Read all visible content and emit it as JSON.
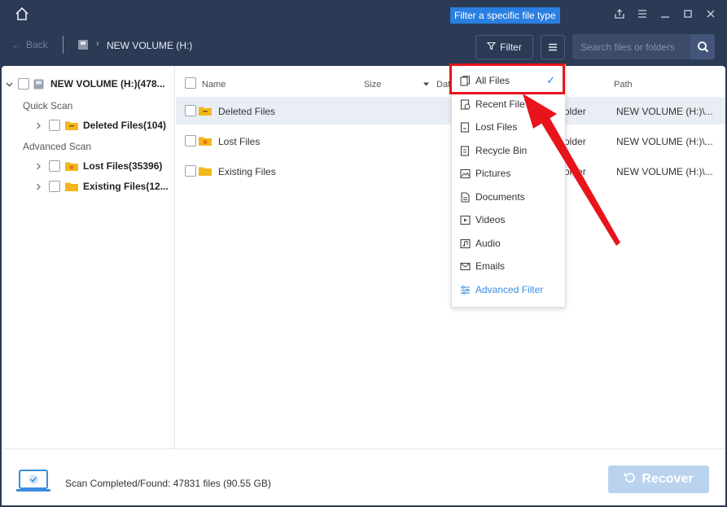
{
  "tooltip": "Filter a specific file type",
  "nav": {
    "back_label": "Back",
    "breadcrumb": "NEW VOLUME (H:)",
    "filter_label": "Filter",
    "search_placeholder": "Search files or folders"
  },
  "sidebar": {
    "root_label": "NEW VOLUME (H:)(478...",
    "quick_scan_label": "Quick Scan",
    "advanced_scan_label": "Advanced Scan",
    "items": [
      {
        "label": "Deleted Files(104)"
      },
      {
        "label": "Lost Files(35396)"
      },
      {
        "label": "Existing Files(12..."
      }
    ]
  },
  "table": {
    "headers": {
      "name": "Name",
      "size": "Size",
      "date": "Dat",
      "path": "Path"
    },
    "rows": [
      {
        "name": "Deleted Files",
        "type": "older",
        "path": "NEW VOLUME (H:)\\..."
      },
      {
        "name": "Lost Files",
        "type": "older",
        "path": "NEW VOLUME (H:)\\..."
      },
      {
        "name": "Existing Files",
        "type": "older",
        "path": "NEW VOLUME (H:)\\..."
      }
    ]
  },
  "dropdown": {
    "items": [
      {
        "label": "All Files",
        "icon": "all-files-icon",
        "checked": true
      },
      {
        "label": "Recent Files",
        "icon": "recent-files-icon"
      },
      {
        "label": "Lost Files",
        "icon": "lost-files-icon"
      },
      {
        "label": "Recycle Bin",
        "icon": "recycle-bin-icon"
      },
      {
        "label": "Pictures",
        "icon": "pictures-icon"
      },
      {
        "label": "Documents",
        "icon": "documents-icon"
      },
      {
        "label": "Videos",
        "icon": "videos-icon"
      },
      {
        "label": "Audio",
        "icon": "audio-icon"
      },
      {
        "label": "Emails",
        "icon": "emails-icon"
      },
      {
        "label": "Advanced Filter",
        "icon": "advanced-filter-icon"
      }
    ],
    "recent_display": "Recent File"
  },
  "status": {
    "text": "Scan Completed/Found: 47831 files (90.55 GB)",
    "recover_label": "Recover"
  },
  "colors": {
    "header_bg": "#2b3a55",
    "accent": "#2a7fe0",
    "highlight": "#e8141c",
    "recover_disabled": "#b9d3ee"
  }
}
